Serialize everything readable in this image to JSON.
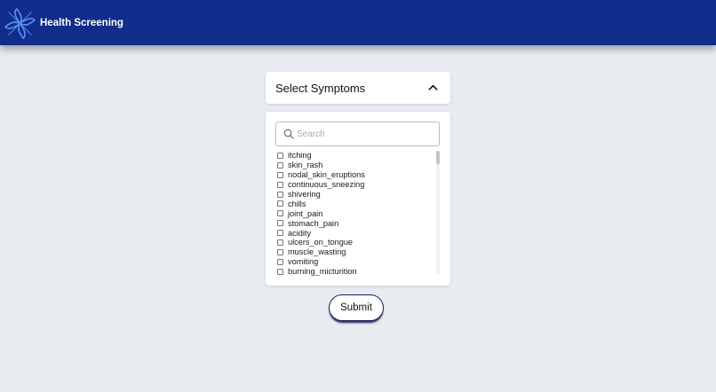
{
  "navbar": {
    "brand": "Health Screening",
    "color": "#112d8c"
  },
  "dropdown": {
    "title": "Select Symptoms",
    "toggle_icon": "chevron-up-icon",
    "search": {
      "placeholder": "Search",
      "value": ""
    },
    "options": [
      "itching",
      "skin_rash",
      "nodal_skin_eruptions",
      "continuous_sneezing",
      "shivering",
      "chills",
      "joint_pain",
      "stomach_pain",
      "acidity",
      "ulcers_on_tongue",
      "muscle_wasting",
      "vomiting",
      "burning_micturition"
    ],
    "scroll_position": 0
  },
  "form": {
    "submit_label": "Submit"
  }
}
